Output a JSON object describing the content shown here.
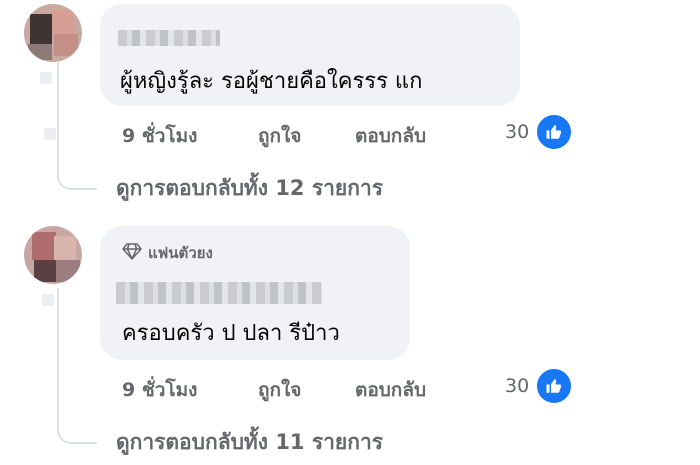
{
  "comments": [
    {
      "author_name_hidden": true,
      "text": "ผู้หญิงรู้ละ รอผู้ชายคือใครรร แก",
      "time": "9 ชั่วโมง",
      "like_action": "ถูกใจ",
      "reply_action": "ตอบกลับ",
      "reaction_count": "30",
      "view_replies": "ดูการตอบกลับทั้ง 12 รายการ"
    },
    {
      "author_name_hidden": true,
      "badge": "แฟนตัวยง",
      "text": "ครอบครัว ป ปลา รีป๋าว",
      "time": "9 ชั่วโมง",
      "like_action": "ถูกใจ",
      "reply_action": "ตอบกลับ",
      "reaction_count": "30",
      "view_replies": "ดูการตอบกลับทั้ง 11 รายการ"
    }
  ],
  "icons": {
    "like": "thumbs-up-icon",
    "badge": "diamond-icon"
  },
  "colors": {
    "bubble": "#f0f2f5",
    "muted_text": "#65676b",
    "like_blue": "#1877f2"
  }
}
